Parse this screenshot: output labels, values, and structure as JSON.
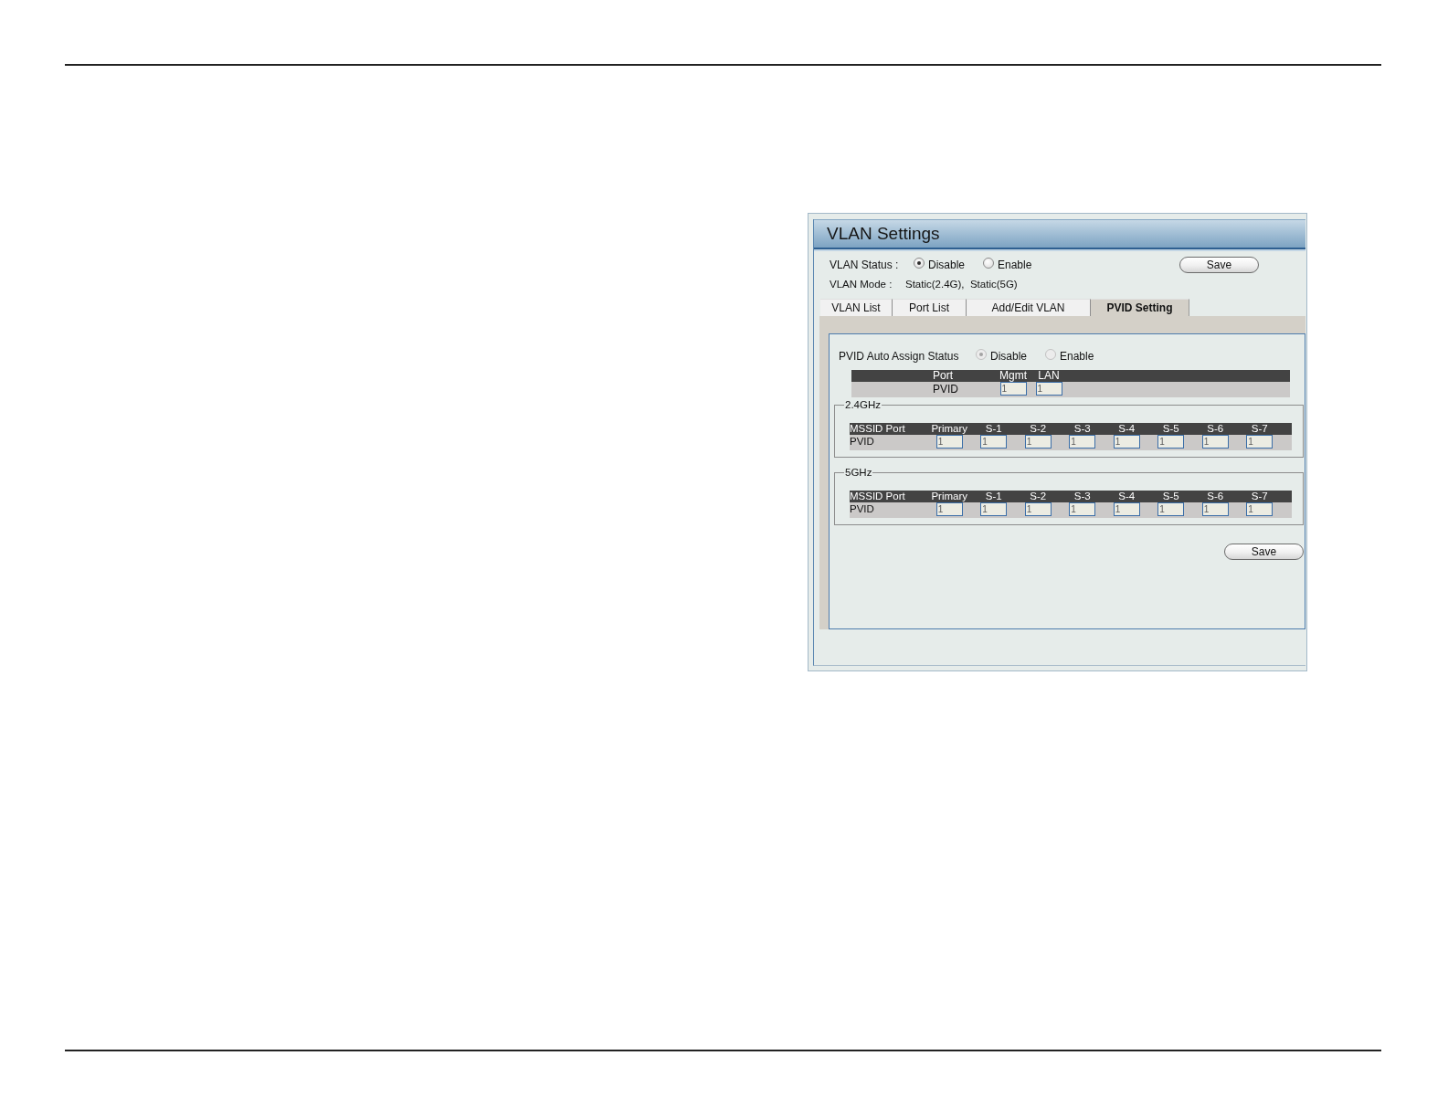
{
  "panel": {
    "title": "VLAN Settings"
  },
  "vlan_status": {
    "label": "VLAN Status :",
    "options": [
      {
        "label": "Disable",
        "selected": true,
        "disabled": false
      },
      {
        "label": "Enable",
        "selected": false,
        "disabled": false
      }
    ],
    "save_button": "Save"
  },
  "vlan_mode": {
    "label": "VLAN Mode :",
    "value": "Static(2.4G),  Static(5G)"
  },
  "tabs": [
    {
      "label": "VLAN List",
      "selected": false
    },
    {
      "label": "Port List",
      "selected": false
    },
    {
      "label": "Add/Edit VLAN",
      "selected": false
    },
    {
      "label": "PVID Setting",
      "selected": true
    }
  ],
  "pvid_setting": {
    "auto_assign": {
      "label": "PVID Auto Assign Status",
      "options": [
        {
          "label": "Disable",
          "selected": true,
          "disabled": true
        },
        {
          "label": "Enable",
          "selected": false,
          "disabled": true
        }
      ]
    },
    "port_table": {
      "columns": [
        "Port",
        "Mgmt",
        "LAN"
      ],
      "row_label": "PVID",
      "values": [
        "1",
        "1"
      ]
    },
    "bands": [
      {
        "legend": "2.4GHz",
        "table": {
          "columns": [
            "MSSID Port",
            "Primary",
            "S-1",
            "S-2",
            "S-3",
            "S-4",
            "S-5",
            "S-6",
            "S-7"
          ],
          "row_label": "PVID",
          "values": [
            "1",
            "1",
            "1",
            "1",
            "1",
            "1",
            "1",
            "1"
          ]
        }
      },
      {
        "legend": "5GHz",
        "table": {
          "columns": [
            "MSSID Port",
            "Primary",
            "S-1",
            "S-2",
            "S-3",
            "S-4",
            "S-5",
            "S-6",
            "S-7"
          ],
          "row_label": "PVID",
          "values": [
            "1",
            "1",
            "1",
            "1",
            "1",
            "1",
            "1",
            "1"
          ]
        }
      }
    ],
    "save_button": "Save"
  }
}
